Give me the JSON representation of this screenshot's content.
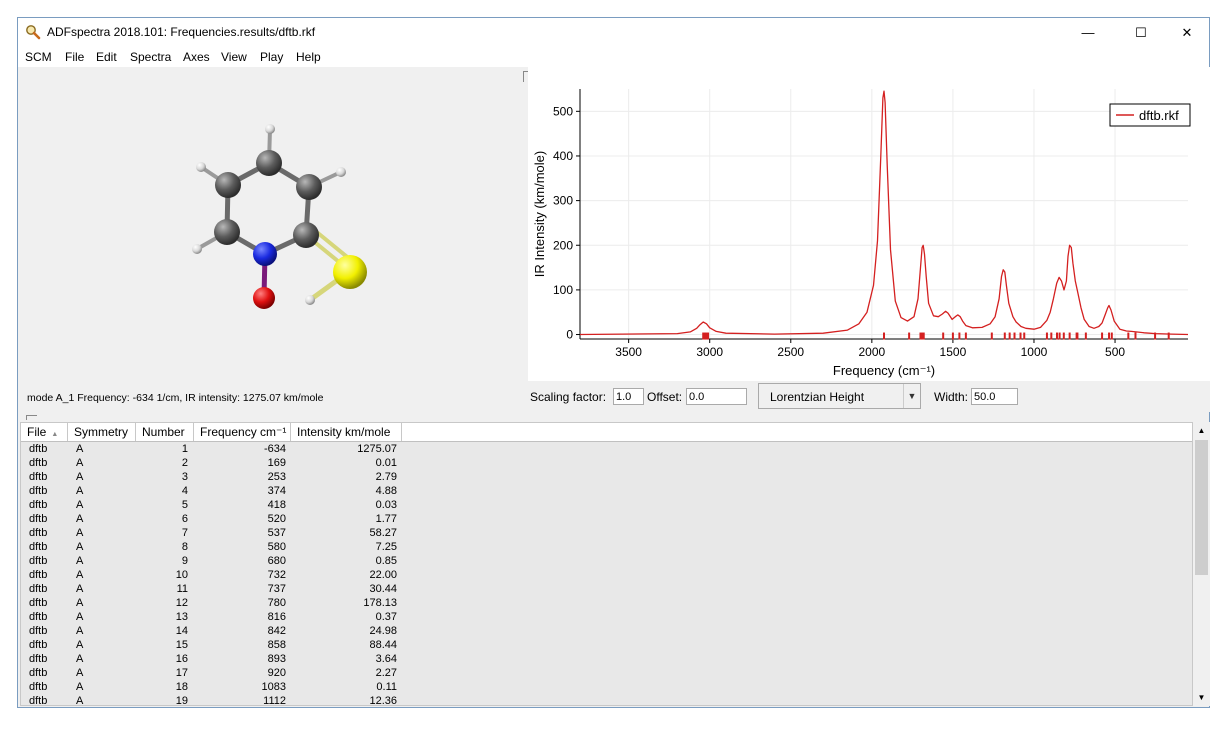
{
  "window": {
    "title": "ADFspectra 2018.101: Frequencies.results/dftb.rkf",
    "icon": "magnifier-app-icon"
  },
  "window_controls": {
    "minimize": "—",
    "maximize": "☐",
    "close": "✕"
  },
  "menu": [
    "SCM",
    "File",
    "Edit",
    "Spectra",
    "Axes",
    "View",
    "Play",
    "Help"
  ],
  "molecule": {
    "mode_text": "mode A_1 Frequency: -634 1/cm, IR intensity: 1275.07 km/mole"
  },
  "chart_data": {
    "type": "line",
    "xlabel": "Frequency (cm⁻¹)",
    "ylabel": "IR Intensity (km/mole)",
    "xlim": [
      3800,
      50
    ],
    "ylim": [
      -10,
      550
    ],
    "xticks": [
      3500,
      3000,
      2500,
      2000,
      1500,
      1000,
      500
    ],
    "yticks": [
      0,
      100,
      200,
      300,
      400,
      500
    ],
    "grid": true,
    "legend_position": "top-right",
    "series": [
      {
        "name": "dftb.rkf",
        "color": "#d42020",
        "x": [
          3800,
          3200,
          3120,
          3080,
          3060,
          3040,
          3020,
          3000,
          2960,
          2900,
          2600,
          2300,
          2150,
          2080,
          2030,
          1990,
          1965,
          1945,
          1932,
          1925,
          1918,
          1905,
          1885,
          1855,
          1820,
          1780,
          1740,
          1715,
          1700,
          1690,
          1683,
          1675,
          1665,
          1650,
          1620,
          1590,
          1565,
          1545,
          1530,
          1505,
          1485,
          1470,
          1455,
          1440,
          1420,
          1380,
          1320,
          1270,
          1240,
          1215,
          1200,
          1190,
          1180,
          1170,
          1155,
          1130,
          1110,
          1080,
          1050,
          1000,
          960,
          920,
          900,
          880,
          860,
          845,
          830,
          815,
          800,
          790,
          780,
          770,
          760,
          745,
          730,
          710,
          690,
          660,
          630,
          600,
          580,
          560,
          545,
          537,
          525,
          505,
          470,
          430,
          400,
          370,
          320,
          250,
          150,
          50
        ],
        "values": [
          0,
          2,
          6,
          14,
          22,
          28,
          24,
          15,
          7,
          3,
          1,
          3,
          10,
          24,
          50,
          110,
          210,
          400,
          530,
          545,
          520,
          380,
          190,
          75,
          38,
          30,
          40,
          80,
          150,
          195,
          200,
          180,
          130,
          70,
          42,
          40,
          46,
          52,
          48,
          34,
          40,
          44,
          40,
          30,
          20,
          15,
          16,
          24,
          40,
          80,
          130,
          145,
          140,
          110,
          70,
          40,
          28,
          18,
          14,
          12,
          16,
          32,
          50,
          80,
          115,
          128,
          120,
          100,
          120,
          175,
          200,
          195,
          160,
          120,
          95,
          60,
          34,
          18,
          14,
          18,
          26,
          45,
          60,
          65,
          55,
          30,
          12,
          8,
          7,
          6,
          4,
          2,
          1,
          0
        ]
      }
    ],
    "sticks": [
      3040,
      3030,
      3020,
      3010,
      1925,
      1770,
      1700,
      1690,
      1680,
      1560,
      1500,
      1460,
      1420,
      1260,
      1180,
      1150,
      1120,
      1083,
      1060,
      920,
      893,
      858,
      842,
      816,
      780,
      737,
      732,
      680,
      580,
      537,
      520,
      418,
      374,
      253,
      169
    ]
  },
  "controls": {
    "scaling_label": "Scaling factor:",
    "scaling_value": "1.0",
    "offset_label": "Offset:",
    "offset_value": "0.0",
    "lineshape": "Lorentzian Height",
    "width_label": "Width:",
    "width_value": "50.0"
  },
  "table": {
    "headers": [
      "File",
      "Symmetry",
      "Number",
      "Frequency cm⁻¹",
      "Intensity km/mole"
    ],
    "rows": [
      [
        "dftb",
        "A",
        "1",
        "-634",
        "1275.07"
      ],
      [
        "dftb",
        "A",
        "2",
        "169",
        "0.01"
      ],
      [
        "dftb",
        "A",
        "3",
        "253",
        "2.79"
      ],
      [
        "dftb",
        "A",
        "4",
        "374",
        "4.88"
      ],
      [
        "dftb",
        "A",
        "5",
        "418",
        "0.03"
      ],
      [
        "dftb",
        "A",
        "6",
        "520",
        "1.77"
      ],
      [
        "dftb",
        "A",
        "7",
        "537",
        "58.27"
      ],
      [
        "dftb",
        "A",
        "8",
        "580",
        "7.25"
      ],
      [
        "dftb",
        "A",
        "9",
        "680",
        "0.85"
      ],
      [
        "dftb",
        "A",
        "10",
        "732",
        "22.00"
      ],
      [
        "dftb",
        "A",
        "11",
        "737",
        "30.44"
      ],
      [
        "dftb",
        "A",
        "12",
        "780",
        "178.13"
      ],
      [
        "dftb",
        "A",
        "13",
        "816",
        "0.37"
      ],
      [
        "dftb",
        "A",
        "14",
        "842",
        "24.98"
      ],
      [
        "dftb",
        "A",
        "15",
        "858",
        "88.44"
      ],
      [
        "dftb",
        "A",
        "16",
        "893",
        "3.64"
      ],
      [
        "dftb",
        "A",
        "17",
        "920",
        "2.27"
      ],
      [
        "dftb",
        "A",
        "18",
        "1083",
        "0.11"
      ],
      [
        "dftb",
        "A",
        "19",
        "1112",
        "12.36"
      ]
    ]
  }
}
